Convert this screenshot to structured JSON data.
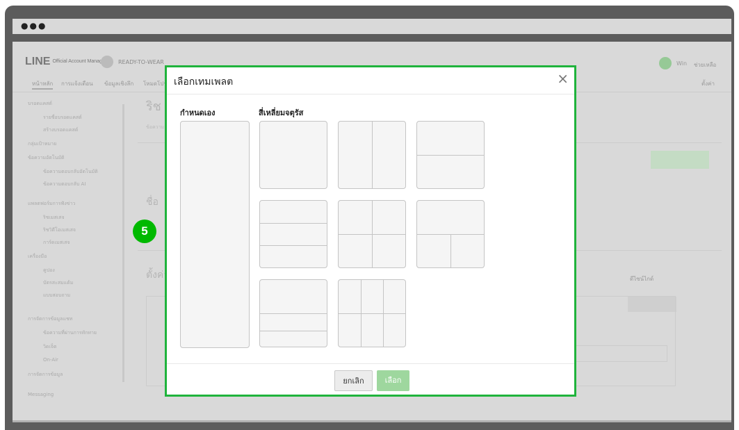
{
  "window": {
    "dots": "●●●"
  },
  "header": {
    "logo_main": "LINE",
    "logo_sub": "Official Account Manager",
    "account_name": "READY-TO-WEAR",
    "user_name": "Win",
    "help_label": "ช่วยเหลือ"
  },
  "nav": {
    "tabs": [
      "หน้าหลัก",
      "การแจ้งเตือน",
      "ข้อมูลเชิงลึก",
      "โหมดโปรไฟล์"
    ],
    "settings_label": "ตั้งค่า"
  },
  "sidebar": {
    "items": [
      {
        "label": "บรอดแคสต์",
        "sub": false
      },
      {
        "label": "รายชื่อบรอดแคสต์",
        "sub": true
      },
      {
        "label": "สร้างบรอดแคสต์",
        "sub": true
      },
      {
        "label": "กลุ่มเป้าหมาย",
        "sub": false
      },
      {
        "label": "ข้อความอัตโนมัติ",
        "sub": false
      },
      {
        "label": "ข้อความตอบกลับอัตโนมัติ",
        "sub": true
      },
      {
        "label": "ข้อความตอบกลับ AI",
        "sub": true
      },
      {
        "label": "แพลตฟอร์มการฟังข่าว",
        "sub": false
      },
      {
        "label": "ริชเมสเสจ",
        "sub": true
      },
      {
        "label": "ริชวิดีโอเมสเสจ",
        "sub": true
      },
      {
        "label": "การ์ดเมสเสจ",
        "sub": true
      },
      {
        "label": "เครื่องมือ",
        "sub": false
      },
      {
        "label": "คูปอง",
        "sub": true
      },
      {
        "label": "บัตรสะสมแต้ม",
        "sub": true
      },
      {
        "label": "แบบสอบถาม",
        "sub": true
      },
      {
        "label": "การจัดการข้อมูลแชท",
        "sub": false
      },
      {
        "label": "ข้อความที่ผ่านการทักทาย",
        "sub": true
      },
      {
        "label": "วิดเจ็ต",
        "sub": true
      },
      {
        "label": "On-Air",
        "sub": true
      },
      {
        "label": "การจัดการข้อมูล",
        "sub": false
      },
      {
        "label": "Messaging",
        "sub": false
      }
    ]
  },
  "content": {
    "title": "ริช",
    "subtitle": "ข้อความ",
    "name_label": "ชื่อ",
    "settings_label": "ตั้งค่า",
    "preview_label": "ดีไซน์ไกด์"
  },
  "modal": {
    "title": "เลือกเทมเพลต",
    "close_icon": "×",
    "section_custom": "กำหนดเอง",
    "section_square": "สี่เหลี่ยมจตุรัส",
    "cancel_label": "ยกเลิก",
    "select_label": "เลือก"
  },
  "step_badge": "5",
  "colors": {
    "accent_green": "#1fb33c",
    "badge_green": "#00b900",
    "select_button": "#9ed79e"
  }
}
